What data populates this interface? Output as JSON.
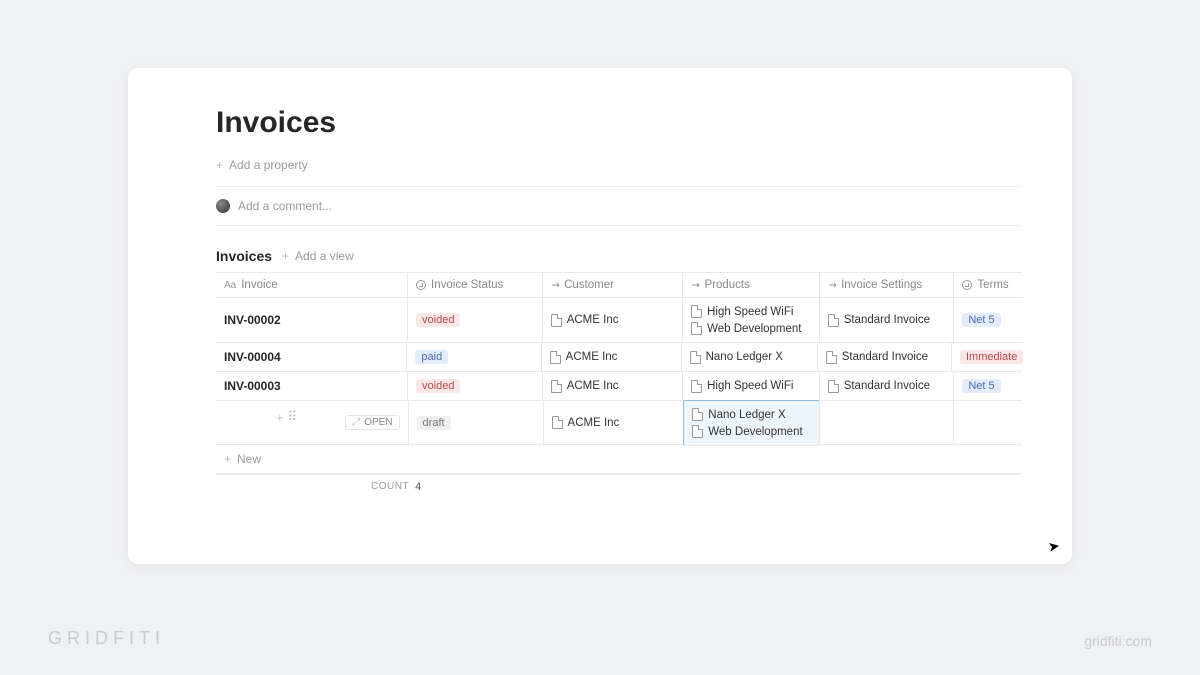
{
  "page": {
    "title": "Invoices",
    "add_property": "Add a property",
    "add_comment_placeholder": "Add a comment..."
  },
  "view": {
    "title": "Invoices",
    "add_view": "Add a view"
  },
  "columns": {
    "invoice": "Invoice",
    "status": "Invoice Status",
    "customer": "Customer",
    "products": "Products",
    "settings": "Invoice Settings",
    "terms": "Terms"
  },
  "status_labels": {
    "voided": "voided",
    "paid": "paid",
    "draft": "draft"
  },
  "terms_labels": {
    "net5": "Net 5",
    "immediate": "Immediate"
  },
  "rows": [
    {
      "id": "INV-00002",
      "status": "voided",
      "customer": "ACME Inc",
      "products": [
        "High Speed WiFi",
        "Web Development"
      ],
      "settings": "Standard Invoice",
      "terms": "net5"
    },
    {
      "id": "INV-00004",
      "status": "paid",
      "customer": "ACME Inc",
      "products": [
        "Nano Ledger X"
      ],
      "settings": "Standard Invoice",
      "terms": "immediate"
    },
    {
      "id": "INV-00003",
      "status": "voided",
      "customer": "ACME Inc",
      "products": [
        "High Speed WiFi"
      ],
      "settings": "Standard Invoice",
      "terms": "net5"
    },
    {
      "id": "",
      "status": "draft",
      "customer": "ACME Inc",
      "products": [
        "Nano Ledger X",
        "Web Development"
      ],
      "settings": "",
      "terms": ""
    }
  ],
  "open_button": "OPEN",
  "new_label": "New",
  "count_label": "COUNT",
  "count_value": "4",
  "footer": {
    "brand": "GRIDFITI",
    "url": "gridfiti.com"
  }
}
